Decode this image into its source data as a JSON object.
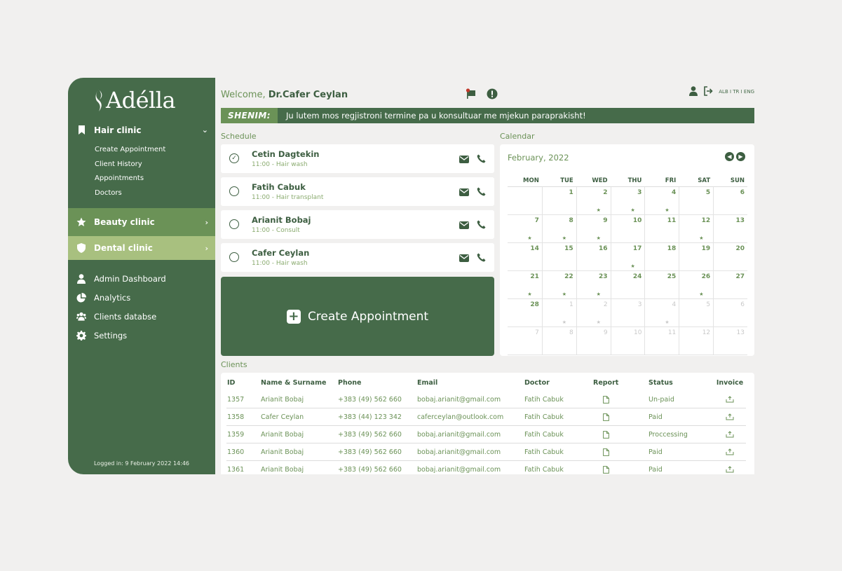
{
  "app": {
    "logo_text": "Adélla"
  },
  "sidebar": {
    "hair": {
      "label": "Hair clinic",
      "items": [
        "Create Appointment",
        "Client History",
        "Appointments",
        "Doctors"
      ]
    },
    "beauty": {
      "label": "Beauty clinic"
    },
    "dental": {
      "label": "Dental clinic"
    },
    "admin": [
      {
        "label": "Admin Dashboard",
        "icon": "user-icon"
      },
      {
        "label": "Analytics",
        "icon": "pie-chart-icon"
      },
      {
        "label": "Clients databse",
        "icon": "users-icon"
      },
      {
        "label": "Settings",
        "icon": "gear-icon"
      }
    ],
    "logged_in": "Logged in: 9 February 2022 14:46"
  },
  "header": {
    "welcome_prefix": "Welcome,",
    "user_name": "Dr.Cafer Ceylan",
    "languages": "ALB I TR I ENG"
  },
  "notice": {
    "tag": "SHENIM:",
    "message": "Ju lutem mos regjistroni termine pa u konsultuar me mjekun paraprakisht!"
  },
  "schedule": {
    "label": "Schedule",
    "items": [
      {
        "name": "Cetin Dagtekin",
        "detail": "11:00 - Hair wash",
        "done": true
      },
      {
        "name": "Fatih Cabuk",
        "detail": "11:00 - Hair transplant",
        "done": false
      },
      {
        "name": "Arianit Bobaj",
        "detail": "11:00 - Consult",
        "done": false
      },
      {
        "name": "Cafer Ceylan",
        "detail": "11:00 - Hair wash",
        "done": false
      }
    ],
    "create_label": "Create Appointment"
  },
  "calendar": {
    "label": "Calendar",
    "month": "February, 2022",
    "weekdays": [
      "MON",
      "TUE",
      "WED",
      "THU",
      "FRI",
      "SAT",
      "SUN"
    ],
    "weeks": [
      [
        {
          "d": "",
          "m": false,
          "s": false
        },
        {
          "d": "1",
          "m": false,
          "s": false
        },
        {
          "d": "2",
          "m": false,
          "s": true
        },
        {
          "d": "3",
          "m": false,
          "s": true
        },
        {
          "d": "4",
          "m": false,
          "s": true
        },
        {
          "d": "5",
          "m": false,
          "s": false
        },
        {
          "d": "6",
          "m": false,
          "s": false
        }
      ],
      [
        {
          "d": "7",
          "m": false,
          "s": true
        },
        {
          "d": "8",
          "m": false,
          "s": true
        },
        {
          "d": "9",
          "m": false,
          "s": true
        },
        {
          "d": "10",
          "m": false,
          "s": false
        },
        {
          "d": "11",
          "m": false,
          "s": false
        },
        {
          "d": "12",
          "m": false,
          "s": true
        },
        {
          "d": "13",
          "m": false,
          "s": false
        }
      ],
      [
        {
          "d": "14",
          "m": false,
          "s": false
        },
        {
          "d": "15",
          "m": false,
          "s": false
        },
        {
          "d": "16",
          "m": false,
          "s": false
        },
        {
          "d": "17",
          "m": false,
          "s": true
        },
        {
          "d": "18",
          "m": false,
          "s": false
        },
        {
          "d": "19",
          "m": false,
          "s": false
        },
        {
          "d": "20",
          "m": false,
          "s": false
        }
      ],
      [
        {
          "d": "21",
          "m": false,
          "s": true
        },
        {
          "d": "22",
          "m": false,
          "s": true
        },
        {
          "d": "23",
          "m": false,
          "s": true
        },
        {
          "d": "24",
          "m": false,
          "s": false
        },
        {
          "d": "25",
          "m": false,
          "s": false
        },
        {
          "d": "26",
          "m": false,
          "s": true
        },
        {
          "d": "27",
          "m": false,
          "s": false
        }
      ],
      [
        {
          "d": "28",
          "m": false,
          "s": false
        },
        {
          "d": "1",
          "m": true,
          "s": true
        },
        {
          "d": "2",
          "m": true,
          "s": true
        },
        {
          "d": "3",
          "m": true,
          "s": false
        },
        {
          "d": "4",
          "m": true,
          "s": true
        },
        {
          "d": "5",
          "m": true,
          "s": false
        },
        {
          "d": "6",
          "m": true,
          "s": false
        }
      ],
      [
        {
          "d": "7",
          "m": true,
          "s": false
        },
        {
          "d": "8",
          "m": true,
          "s": false
        },
        {
          "d": "9",
          "m": true,
          "s": false
        },
        {
          "d": "10",
          "m": true,
          "s": false
        },
        {
          "d": "11",
          "m": true,
          "s": false
        },
        {
          "d": "12",
          "m": true,
          "s": false
        },
        {
          "d": "13",
          "m": true,
          "s": false
        }
      ]
    ]
  },
  "clients": {
    "label": "Clients",
    "columns": [
      "ID",
      "Name & Surname",
      "Phone",
      "Email",
      "Doctor",
      "Report",
      "Status",
      "Invoice"
    ],
    "rows": [
      {
        "id": "1357",
        "name": "Arianit Bobaj",
        "phone": "+383 (49) 562 660",
        "email": "bobaj.arianit@gmail.com",
        "doctor": "Fatih Cabuk",
        "status": "Un-paid"
      },
      {
        "id": "1358",
        "name": "Cafer Ceylan",
        "phone": "+383 (44) 123 342",
        "email": "caferceylan@outlook.com",
        "doctor": "Fatih Cabuk",
        "status": "Paid"
      },
      {
        "id": "1359",
        "name": "Arianit Bobaj",
        "phone": "+383 (49) 562 660",
        "email": "bobaj.arianit@gmail.com",
        "doctor": "Fatih Cabuk",
        "status": "Proccessing"
      },
      {
        "id": "1360",
        "name": "Arianit Bobaj",
        "phone": "+383 (49) 562 660",
        "email": "bobaj.arianit@gmail.com",
        "doctor": "Fatih Cabuk",
        "status": "Paid"
      },
      {
        "id": "1361",
        "name": "Arianit Bobaj",
        "phone": "+383 (49) 562 660",
        "email": "bobaj.arianit@gmail.com",
        "doctor": "Fatih Cabuk",
        "status": "Paid"
      }
    ]
  },
  "colors": {
    "primary": "#466b4a",
    "accent": "#6b9257",
    "light": "#a8c07f",
    "background": "#f1f0ef"
  }
}
